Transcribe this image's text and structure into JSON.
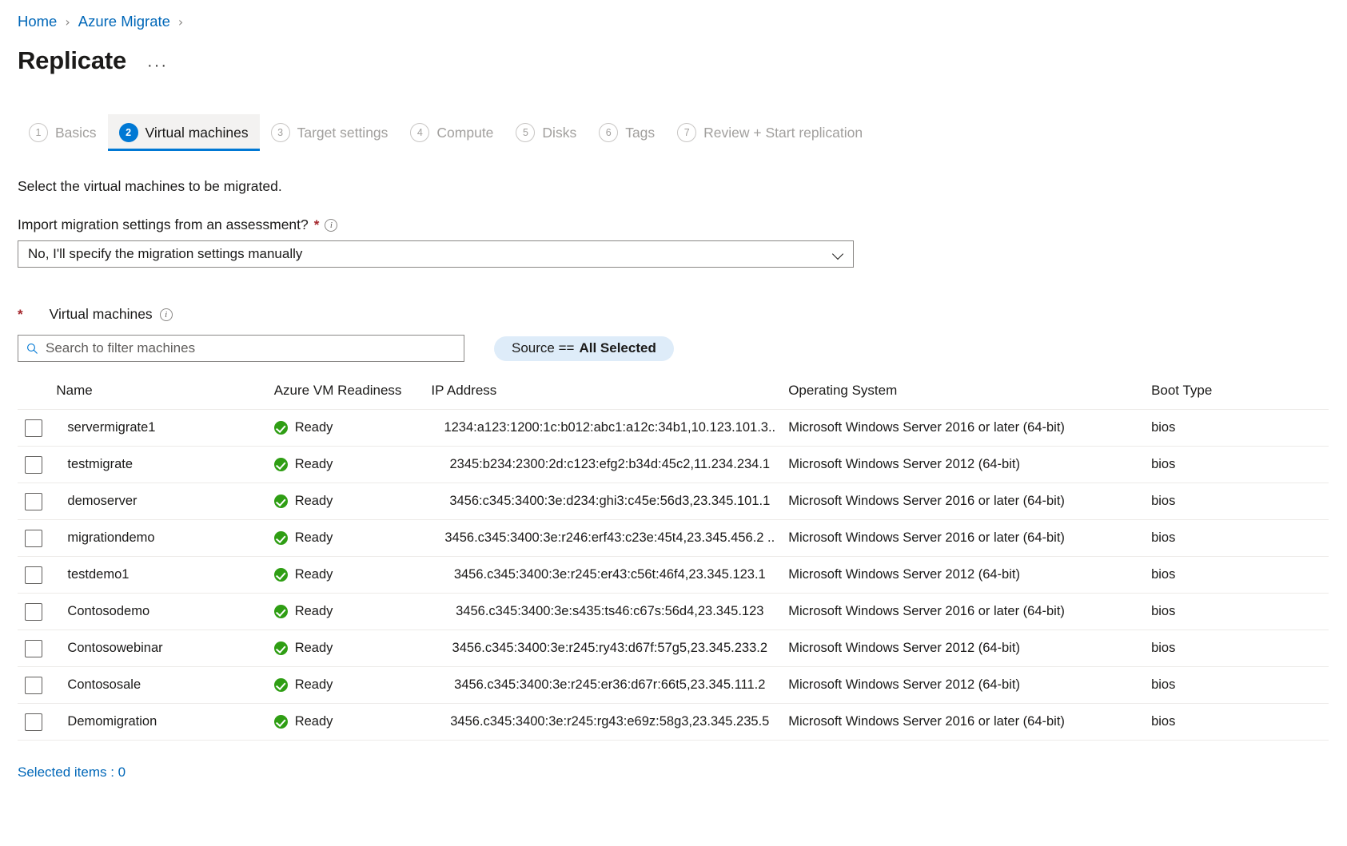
{
  "breadcrumb": {
    "items": [
      {
        "label": "Home"
      },
      {
        "label": "Azure Migrate"
      }
    ],
    "separator": "›"
  },
  "header": {
    "title": "Replicate",
    "more_label": "···"
  },
  "wizard": {
    "tabs": [
      {
        "num": "1",
        "label": "Basics",
        "active": false
      },
      {
        "num": "2",
        "label": "Virtual machines",
        "active": true
      },
      {
        "num": "3",
        "label": "Target settings",
        "active": false
      },
      {
        "num": "4",
        "label": "Compute",
        "active": false
      },
      {
        "num": "5",
        "label": "Disks",
        "active": false
      },
      {
        "num": "6",
        "label": "Tags",
        "active": false
      },
      {
        "num": "7",
        "label": "Review + Start replication",
        "active": false
      }
    ]
  },
  "form": {
    "intro": "Select the virtual machines to be migrated.",
    "import_label": "Import migration settings from an assessment?",
    "import_value": "No, I'll specify the migration settings manually",
    "vm_section_label": "Virtual machines"
  },
  "filters": {
    "search_placeholder": "Search to filter machines",
    "pill_prefix": "Source ==",
    "pill_value": "All Selected"
  },
  "table": {
    "headers": {
      "name": "Name",
      "readiness": "Azure VM Readiness",
      "ip": "IP Address",
      "os": "Operating System",
      "boot": "Boot Type"
    },
    "rows": [
      {
        "name": "servermigrate1",
        "readiness": "Ready",
        "ip": "1234:a123:1200:1c:b012:abc1:a12c:34b1,10.123.101.3..",
        "os": "Microsoft Windows Server 2016 or later (64-bit)",
        "boot": "bios"
      },
      {
        "name": "testmigrate",
        "readiness": "Ready",
        "ip": "2345:b234:2300:2d:c123:efg2:b34d:45c2,11.234.234.1",
        "os": "Microsoft Windows Server 2012 (64-bit)",
        "boot": "bios"
      },
      {
        "name": "demoserver",
        "readiness": "Ready",
        "ip": "3456:c345:3400:3e:d234:ghi3:c45e:56d3,23.345.101.1",
        "os": "Microsoft Windows Server 2016 or later (64-bit)",
        "boot": "bios"
      },
      {
        "name": "migrationdemo",
        "readiness": "Ready",
        "ip": "3456.c345:3400:3e:r246:erf43:c23e:45t4,23.345.456.2 ..",
        "os": "Microsoft Windows Server 2016 or later (64-bit)",
        "boot": "bios"
      },
      {
        "name": "testdemo1",
        "readiness": "Ready",
        "ip": "3456.c345:3400:3e:r245:er43:c56t:46f4,23.345.123.1",
        "os": "Microsoft Windows Server 2012 (64-bit)",
        "boot": "bios"
      },
      {
        "name": "Contosodemo",
        "readiness": "Ready",
        "ip": "3456.c345:3400:3e:s435:ts46:c67s:56d4,23.345.123",
        "os": "Microsoft Windows Server 2016 or later (64-bit)",
        "boot": "bios"
      },
      {
        "name": "Contosowebinar",
        "readiness": "Ready",
        "ip": "3456.c345:3400:3e:r245:ry43:d67f:57g5,23.345.233.2",
        "os": "Microsoft Windows Server 2012 (64-bit)",
        "boot": "bios"
      },
      {
        "name": "Contososale",
        "readiness": "Ready",
        "ip": "3456.c345:3400:3e:r245:er36:d67r:66t5,23.345.111.2",
        "os": "Microsoft Windows Server 2012 (64-bit)",
        "boot": "bios"
      },
      {
        "name": "Demomigration",
        "readiness": "Ready",
        "ip": "3456.c345:3400:3e:r245:rg43:e69z:58g3,23.345.235.5",
        "os": "Microsoft Windows Server 2016 or later (64-bit)",
        "boot": "bios"
      }
    ]
  },
  "footer": {
    "selected_items": "Selected items : 0"
  },
  "colors": {
    "link": "#0067b8",
    "accent": "#0078d4",
    "required": "#a4262c",
    "success": "#2f9e14",
    "pill_bg": "#deecf9",
    "active_tab_bg": "#f3f2f1"
  }
}
